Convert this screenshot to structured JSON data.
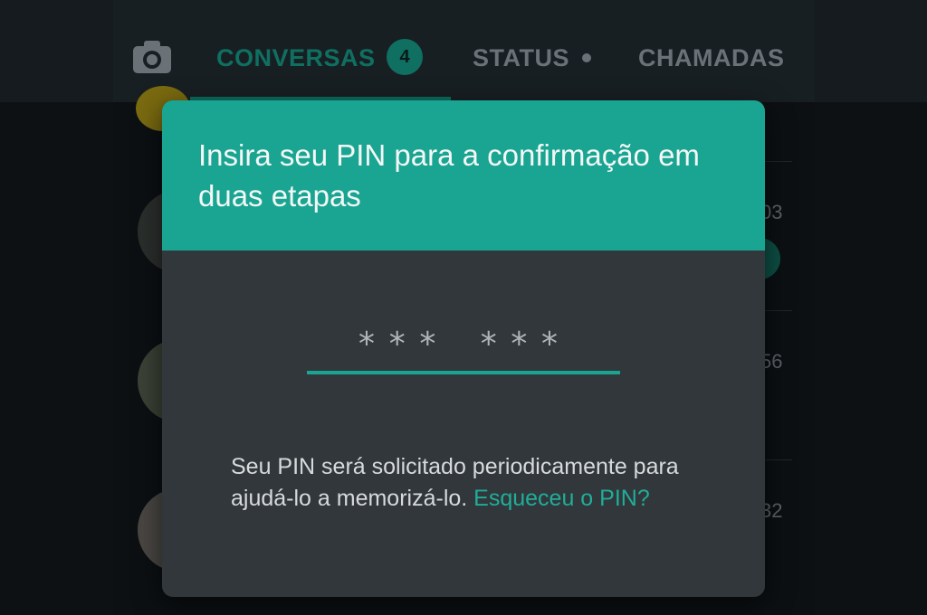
{
  "tabs": {
    "conversas": "CONVERSAS",
    "conversas_badge": "4",
    "status": "STATUS",
    "chamadas": "CHAMADAS"
  },
  "chat_list": {
    "times": [
      "03",
      "56",
      "32"
    ]
  },
  "dialog": {
    "title": "Insira seu PIN para a confirmação em duas etapas",
    "pin_mask": "*** ***",
    "body_text": "Seu PIN será solicitado periodicamente para ajudá-lo a memorizá-lo. ",
    "forgot_link": "Esqueceu o PIN?"
  },
  "colors": {
    "accent": "#1aa592",
    "header_tab_active": "#0f6f61",
    "dialog_bg": "#32373b"
  },
  "icons": {
    "camera": "camera-icon"
  }
}
